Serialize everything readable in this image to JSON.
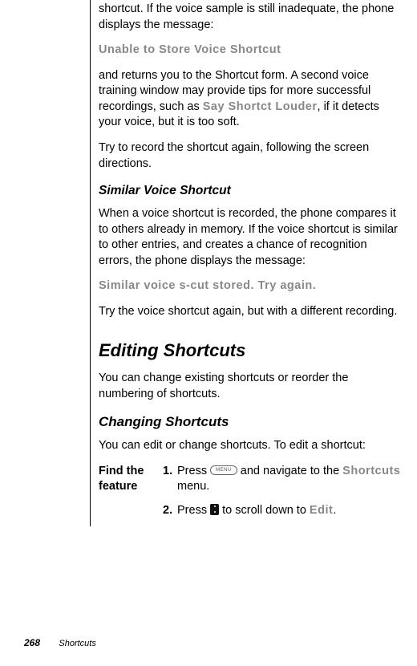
{
  "intro": {
    "p1a": "shortcut. If the voice sample is still inadequate, the phone displays the message:",
    "msg1": "Unable to Store Voice Shortcut",
    "p2a": "and returns you to the Shortcut form. A second voice training window may provide tips for more successful recordings, such as ",
    "p2b": "Say Shortct Louder",
    "p2c": ", if it detects your voice, but it is too soft.",
    "p3": "Try to record the shortcut again, following the screen directions."
  },
  "similar": {
    "heading": "Similar Voice Shortcut",
    "p1": "When a voice shortcut is recorded, the phone compares it to others already in memory. If the voice shortcut is similar to other entries, and creates a chance of recognition errors, the phone displays the message:",
    "msg": "Similar voice s-cut stored. Try again.",
    "p2": "Try the voice shortcut again, but with a different recording."
  },
  "editing": {
    "heading": "Editing Shortcuts",
    "p1": "You can change existing shortcuts or reorder the numbering of shortcuts."
  },
  "changing": {
    "heading": "Changing Shortcuts",
    "p1": "You can edit or change shortcuts. To edit a shortcut:",
    "ff_label_l1": "Find the",
    "ff_label_l2": "feature",
    "step1_num": "1.",
    "step1a": "Press ",
    "menu_label": "MENU",
    "step1b": " and navigate to the ",
    "step1c": "Shortcuts",
    "step1d": " menu.",
    "step2_num": "2.",
    "step2a": "Press ",
    "step2b": " to scroll down to ",
    "step2c": "Edit",
    "step2d": "."
  },
  "footer": {
    "page": "268",
    "chapter": "Shortcuts"
  }
}
